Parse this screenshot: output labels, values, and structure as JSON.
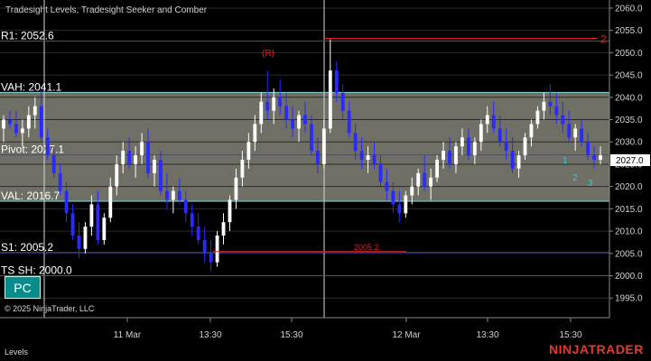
{
  "chart_data": {
    "type": "candlestick",
    "title": "Tradesight Levels, Tradesight Seeker and Comber",
    "x_ticks": [
      "11 Mar",
      "13:30",
      "15:30",
      "12 Mar",
      "13:30",
      "15:30"
    ],
    "y_ticks": [
      "1995.0",
      "2000.0",
      "2005.0",
      "2010.0",
      "2015.0",
      "2020.0",
      "2025.0",
      "2030.0",
      "2035.0",
      "2040.0",
      "2045.0",
      "2050.0",
      "2055.0",
      "2060.0"
    ],
    "ylim": [
      1991,
      2061
    ],
    "last_price": "2027.0",
    "levels": [
      {
        "name": "R1",
        "label": "R1: 2052.6",
        "value": 2052.6,
        "color": "#3a3aff"
      },
      {
        "name": "VAH",
        "label": "VAH: 2041.1",
        "value": 2041.1,
        "color": "#7fd6d6"
      },
      {
        "name": "Pivot",
        "label": "Pivot: 2027.1",
        "value": 2027.1,
        "color": "#3a3aff"
      },
      {
        "name": "VAL",
        "label": "VAL: 2016.7",
        "value": 2016.7,
        "color": "#7fd6d6"
      },
      {
        "name": "S1",
        "label": "S1: 2005.2",
        "value": 2005.2,
        "color": "#3a3aff"
      },
      {
        "name": "TS",
        "label": "TS SH: 2000.0",
        "value": 2000.0,
        "color": "#2a7a2a"
      }
    ],
    "value_area": [
      2016.7,
      2041.1
    ],
    "annotations": {
      "r_marker": "(R)",
      "red_line_label": "2005.2",
      "red_count": "2",
      "counts_blue": [
        "1",
        "2",
        "3"
      ]
    },
    "candles": [
      [
        2033,
        2036,
        2030,
        2035
      ],
      [
        2035,
        2037,
        2033,
        2034
      ],
      [
        2034,
        2037,
        2031,
        2032
      ],
      [
        2032,
        2035,
        2029,
        2033
      ],
      [
        2033,
        2038,
        2031,
        2036
      ],
      [
        2036,
        2040,
        2033,
        2038
      ],
      [
        2038,
        2042,
        2030,
        2031
      ],
      [
        2031,
        2033,
        2026,
        2027
      ],
      [
        2027,
        2029,
        2022,
        2023
      ],
      [
        2023,
        2025,
        2018,
        2019
      ],
      [
        2019,
        2021,
        2012,
        2014
      ],
      [
        2014,
        2016,
        2008,
        2009
      ],
      [
        2009,
        2012,
        2004,
        2006
      ],
      [
        2006,
        2012,
        2005,
        2011
      ],
      [
        2011,
        2018,
        2009,
        2016
      ],
      [
        2016,
        2019,
        2007,
        2008
      ],
      [
        2008,
        2014,
        2007,
        2013
      ],
      [
        2013,
        2022,
        2012,
        2020
      ],
      [
        2020,
        2027,
        2018,
        2025
      ],
      [
        2025,
        2030,
        2023,
        2028
      ],
      [
        2028,
        2031,
        2024,
        2025
      ],
      [
        2025,
        2029,
        2022,
        2027
      ],
      [
        2027,
        2032,
        2025,
        2030
      ],
      [
        2030,
        2033,
        2022,
        2023
      ],
      [
        2023,
        2027,
        2020,
        2026
      ],
      [
        2026,
        2028,
        2018,
        2019
      ],
      [
        2019,
        2023,
        2015,
        2017
      ],
      [
        2017,
        2020,
        2014,
        2019
      ],
      [
        2019,
        2022,
        2016,
        2017
      ],
      [
        2017,
        2019,
        2012,
        2014
      ],
      [
        2014,
        2016,
        2009,
        2011
      ],
      [
        2011,
        2014,
        2007,
        2008
      ],
      [
        2008,
        2011,
        2003,
        2005
      ],
      [
        2005,
        2008,
        2001,
        2003
      ],
      [
        2003,
        2010,
        2002,
        2009
      ],
      [
        2009,
        2014,
        2007,
        2012
      ],
      [
        2012,
        2018,
        2010,
        2017
      ],
      [
        2017,
        2024,
        2015,
        2022
      ],
      [
        2022,
        2028,
        2020,
        2026
      ],
      [
        2026,
        2032,
        2024,
        2030
      ],
      [
        2030,
        2036,
        2028,
        2034
      ],
      [
        2034,
        2041,
        2032,
        2039
      ],
      [
        2039,
        2046,
        2035,
        2037
      ],
      [
        2037,
        2042,
        2034,
        2040
      ],
      [
        2040,
        2044,
        2036,
        2038
      ],
      [
        2038,
        2041,
        2033,
        2035
      ],
      [
        2035,
        2038,
        2031,
        2033
      ],
      [
        2033,
        2037,
        2030,
        2036
      ],
      [
        2036,
        2039,
        2032,
        2034
      ],
      [
        2034,
        2036,
        2027,
        2028
      ],
      [
        2028,
        2031,
        2023,
        2025
      ],
      [
        2025,
        2035,
        2024,
        2033
      ],
      [
        2033,
        2053,
        2032,
        2046
      ],
      [
        2046,
        2048,
        2039,
        2041
      ],
      [
        2041,
        2043,
        2035,
        2037
      ],
      [
        2037,
        2039,
        2031,
        2032
      ],
      [
        2032,
        2034,
        2026,
        2028
      ],
      [
        2028,
        2031,
        2024,
        2026
      ],
      [
        2026,
        2029,
        2023,
        2027
      ],
      [
        2027,
        2030,
        2024,
        2025
      ],
      [
        2025,
        2027,
        2020,
        2021
      ],
      [
        2021,
        2024,
        2017,
        2019
      ],
      [
        2019,
        2021,
        2014,
        2016
      ],
      [
        2016,
        2019,
        2012,
        2014
      ],
      [
        2014,
        2019,
        2013,
        2018
      ],
      [
        2018,
        2022,
        2016,
        2020
      ],
      [
        2020,
        2024,
        2018,
        2023
      ],
      [
        2023,
        2027,
        2019,
        2020
      ],
      [
        2020,
        2024,
        2017,
        2022
      ],
      [
        2022,
        2027,
        2021,
        2026
      ],
      [
        2026,
        2030,
        2024,
        2028
      ],
      [
        2028,
        2031,
        2024,
        2025
      ],
      [
        2025,
        2030,
        2023,
        2029
      ],
      [
        2029,
        2033,
        2027,
        2031
      ],
      [
        2031,
        2033,
        2026,
        2027
      ],
      [
        2027,
        2031,
        2025,
        2030
      ],
      [
        2030,
        2035,
        2028,
        2034
      ],
      [
        2034,
        2038,
        2032,
        2036
      ],
      [
        2036,
        2039,
        2032,
        2033
      ],
      [
        2033,
        2036,
        2029,
        2030
      ],
      [
        2030,
        2033,
        2026,
        2028
      ],
      [
        2028,
        2031,
        2023,
        2024
      ],
      [
        2024,
        2028,
        2022,
        2027
      ],
      [
        2027,
        2032,
        2026,
        2031
      ],
      [
        2031,
        2035,
        2029,
        2034
      ],
      [
        2034,
        2038,
        2033,
        2037
      ],
      [
        2037,
        2041,
        2035,
        2039
      ],
      [
        2039,
        2043,
        2036,
        2038
      ],
      [
        2038,
        2041,
        2034,
        2036
      ],
      [
        2036,
        2039,
        2032,
        2034
      ],
      [
        2034,
        2037,
        2030,
        2031
      ],
      [
        2031,
        2034,
        2028,
        2033
      ],
      [
        2033,
        2035,
        2029,
        2030
      ],
      [
        2030,
        2032,
        2026,
        2027
      ],
      [
        2027,
        2029,
        2024,
        2026
      ],
      [
        2026,
        2029,
        2025,
        2027
      ]
    ]
  },
  "footer": {
    "copyright": "© 2025 NinjaTrader, LLC",
    "panel_label": "Levels",
    "brand": "NINJATRADER"
  },
  "controls": {
    "pc_button": "PC"
  },
  "colors": {
    "up": "#ffffff",
    "down": "#2a2aff",
    "value_area_fill": "#6f6f66",
    "red": "#e02020",
    "green_text": "#1fa01f",
    "count_blue": "#22d3ee",
    "brand_red": "#e8372c"
  }
}
